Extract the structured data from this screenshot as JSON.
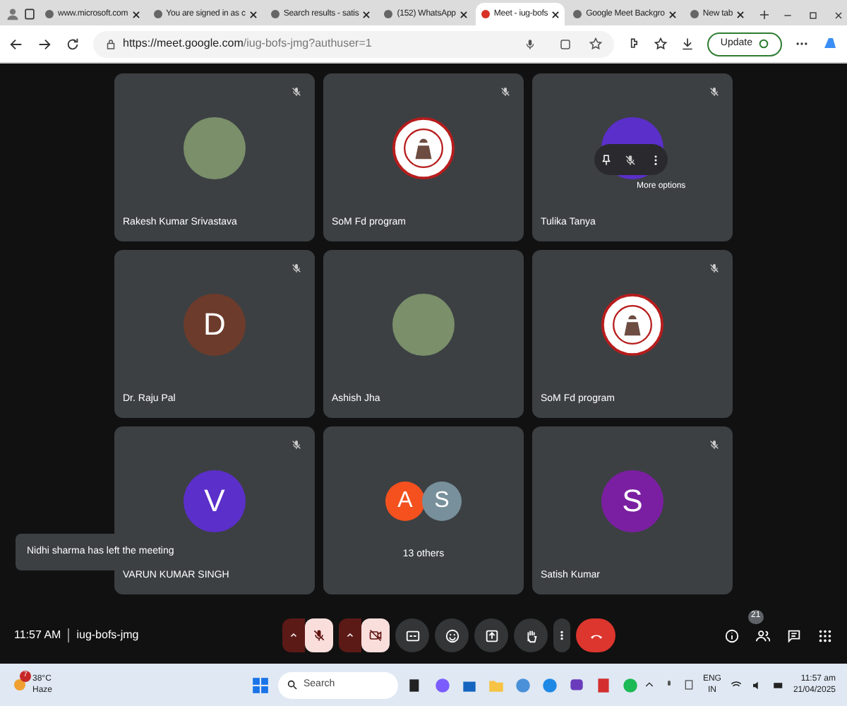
{
  "tabs": [
    {
      "title": "www.microsoft.com",
      "selected": false
    },
    {
      "title": "You are signed in as c",
      "selected": false
    },
    {
      "title": "Search results - satis",
      "selected": false
    },
    {
      "title": "(152) WhatsApp",
      "selected": false
    },
    {
      "title": "Meet - iug-bofs",
      "selected": true
    },
    {
      "title": "Google Meet Backgro",
      "selected": false
    },
    {
      "title": "New tab",
      "selected": false
    }
  ],
  "address": {
    "host": "https://meet.google.com",
    "path": "/iug-bofs-jmg?authuser=1"
  },
  "update_button": "Update",
  "tiles": [
    {
      "name": "Rakesh Kumar Srivastava",
      "kind": "photo",
      "muted": true
    },
    {
      "name": "SoM Fd program",
      "kind": "logo",
      "muted": true
    },
    {
      "name": "Tulika Tanya",
      "kind": "hover",
      "muted": true,
      "color": "#5b2fc9",
      "tooltip": "More options"
    },
    {
      "name": "Dr. Raju Pal",
      "kind": "initial",
      "letter": "D",
      "color": "#6d3b2b",
      "muted": true
    },
    {
      "name": "Ashish Jha",
      "kind": "photo",
      "muted": false
    },
    {
      "name": "SoM Fd program",
      "kind": "logo",
      "muted": true
    },
    {
      "name": "VARUN KUMAR SINGH",
      "kind": "initial",
      "letter": "V",
      "color": "#5b2fc9",
      "muted": true
    },
    {
      "name": "13 others",
      "kind": "others",
      "avatars": [
        {
          "letter": "A",
          "color": "#f4511e"
        },
        {
          "letter": "S",
          "color": "#78909c"
        }
      ],
      "muted": false
    },
    {
      "name": "Satish Kumar",
      "kind": "initial",
      "letter": "S",
      "color": "#7b1fa2",
      "muted": true
    }
  ],
  "toast": "Nidhi sharma has left the meeting",
  "meeting": {
    "time": "11:57 AM",
    "code": "iug-bofs-jmg",
    "participants_count": "21"
  },
  "taskbar": {
    "temp": "38°C",
    "weather": "Haze",
    "weather_badge": "7",
    "search_placeholder": "Search",
    "lang": "ENG",
    "region": "IN",
    "time": "11:57 am",
    "date": "21/04/2025"
  }
}
